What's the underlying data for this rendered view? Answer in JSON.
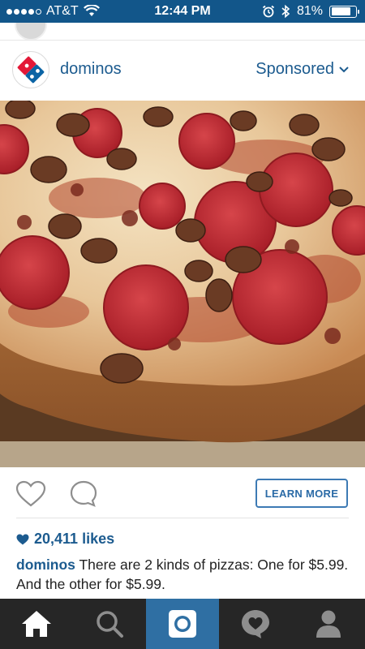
{
  "status_bar": {
    "carrier": "AT&T",
    "time": "12:44 PM",
    "battery_percent": "81%",
    "battery_level": 0.81
  },
  "post": {
    "username": "dominos",
    "sponsored_label": "Sponsored",
    "photo_subject": "pizza-photo",
    "actions": {
      "learn_more_label": "LEARN MORE"
    },
    "likes_text": "20,411 likes",
    "caption": {
      "username": "dominos",
      "text": "There are 2 kinds of pizzas: One for $5.99. And the other for $5.99."
    }
  },
  "tab_bar": {
    "items": [
      {
        "icon": "home-icon",
        "active": true
      },
      {
        "icon": "search-icon",
        "active": false
      },
      {
        "icon": "camera-icon",
        "active": false
      },
      {
        "icon": "activity-icon",
        "active": false
      },
      {
        "icon": "profile-icon",
        "active": false
      }
    ]
  },
  "colors": {
    "status_bar": "#12568a",
    "link_blue": "#1c5b8f",
    "tab_bar": "#262626",
    "camera_tab": "#2f6fa3"
  }
}
